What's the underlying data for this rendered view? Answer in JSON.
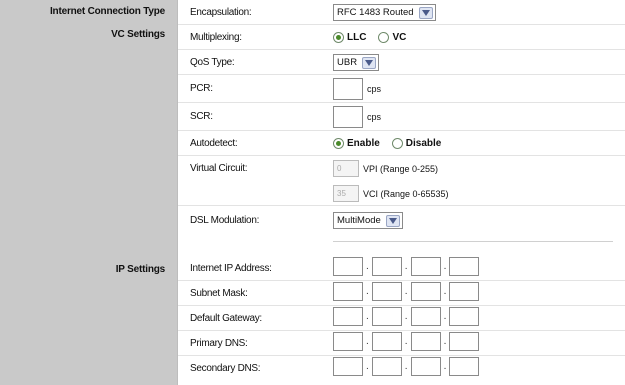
{
  "sidebar": {
    "internet_connection_type": "Internet Connection Type",
    "vc_settings": "VC Settings",
    "ip_settings": "IP Settings"
  },
  "fields": {
    "encapsulation": {
      "label": "Encapsulation:",
      "value": "RFC 1483 Routed"
    },
    "multiplexing": {
      "label": "Multiplexing:",
      "options": [
        "LLC",
        "VC"
      ],
      "selected": "LLC"
    },
    "qos_type": {
      "label": "QoS Type:",
      "value": "UBR"
    },
    "pcr": {
      "label": "PCR:",
      "unit": "cps",
      "value": ""
    },
    "scr": {
      "label": "SCR:",
      "unit": "cps",
      "value": ""
    },
    "autodetect": {
      "label": "Autodetect:",
      "options": [
        "Enable",
        "Disable"
      ],
      "selected": "Enable"
    },
    "virtual_circuit": {
      "label": "Virtual Circuit:",
      "vpi_value": "0",
      "vpi_range": "VPI (Range 0-255)",
      "vci_value": "35",
      "vci_range": "VCI (Range 0-65535)"
    },
    "dsl_modulation": {
      "label": "DSL Modulation:",
      "value": "MultiMode"
    }
  },
  "ip_settings": [
    {
      "label": "Internet IP Address:"
    },
    {
      "label": "Subnet Mask:"
    },
    {
      "label": "Default Gateway:"
    },
    {
      "label": "Primary DNS:"
    },
    {
      "label": "Secondary DNS:"
    }
  ],
  "colors": {
    "sidebar_bg": "#c9c9c9",
    "radio_selected": "#4a8a2a",
    "select_button": "#dfe5f3"
  }
}
